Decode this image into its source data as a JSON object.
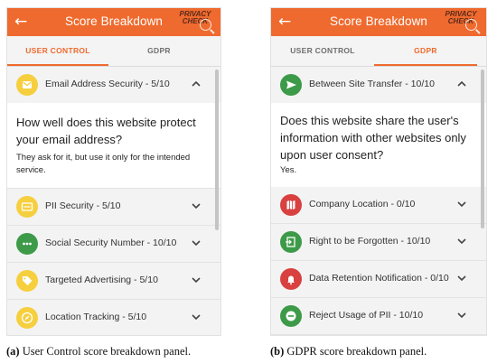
{
  "panel_a": {
    "appbar": {
      "title": "Score Breakdown",
      "logo_line1": "PRIVACY",
      "logo_line2": "CHECK"
    },
    "tabs": [
      {
        "label": "USER CONTROL",
        "active": true
      },
      {
        "label": "GDPR",
        "active": false
      }
    ],
    "expanded": {
      "label": "Email Address Security - 5/10",
      "icon": "envelope-icon",
      "color": "#f6cf3f",
      "question": "How well does this website protect your email address?",
      "answer": "They ask for it, but use it only for the intended service."
    },
    "items": [
      {
        "label": "PII Security - 5/10",
        "icon": "id-card-icon",
        "color": "#f6cf3f"
      },
      {
        "label": "Social Security Number - 10/10",
        "icon": "more-dots-icon",
        "color": "#3d9a48"
      },
      {
        "label": "Targeted Advertising - 5/10",
        "icon": "tag-icon",
        "color": "#f6cf3f"
      },
      {
        "label": "Location Tracking - 5/10",
        "icon": "compass-icon",
        "color": "#f6cf3f"
      }
    ]
  },
  "panel_b": {
    "appbar": {
      "title": "Score Breakdown",
      "logo_line1": "PRIVACY",
      "logo_line2": "CHECK"
    },
    "tabs": [
      {
        "label": "USER CONTROL",
        "active": false
      },
      {
        "label": "GDPR",
        "active": true
      }
    ],
    "expanded": {
      "label": "Between Site Transfer - 10/10",
      "icon": "send-icon",
      "color": "#3d9a48",
      "question": "Does this website share the user's information with other websites only upon user consent?",
      "answer": "Yes."
    },
    "items": [
      {
        "label": "Company Location - 0/10",
        "icon": "map-icon",
        "color": "#d94040"
      },
      {
        "label": "Right to be Forgotten - 10/10",
        "icon": "exit-icon",
        "color": "#3d9a48"
      },
      {
        "label": "Data Retention Notification - 0/10",
        "icon": "bell-icon",
        "color": "#d94040"
      },
      {
        "label": "Reject Usage of PII - 10/10",
        "icon": "block-icon",
        "color": "#3d9a48"
      }
    ]
  },
  "captions": {
    "a_tag": "(a)",
    "a_text": " User Control score breakdown panel.",
    "b_tag": "(b)",
    "b_text": " GDPR score breakdown panel."
  },
  "colors": {
    "accent": "#ef6a2e",
    "good": "#3d9a48",
    "medium": "#f6cf3f",
    "bad": "#d94040"
  }
}
